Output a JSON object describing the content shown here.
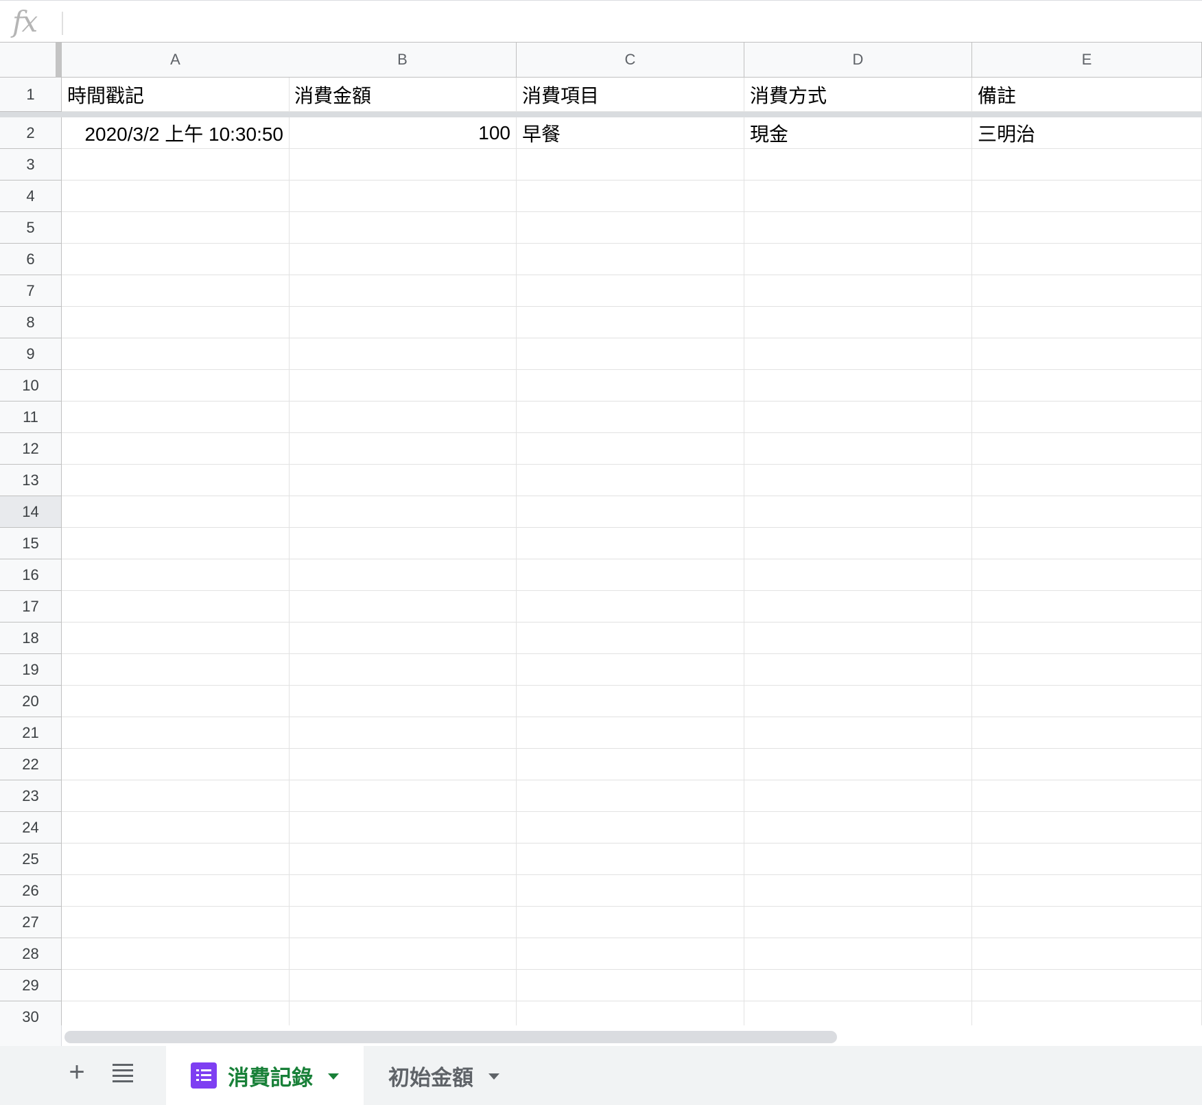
{
  "formula_bar": {
    "fx_label": "fx",
    "value": ""
  },
  "columns": [
    "A",
    "B",
    "C",
    "D",
    "E"
  ],
  "rows": [
    "1",
    "2",
    "3",
    "4",
    "5",
    "6",
    "7",
    "8",
    "9",
    "10",
    "11",
    "12",
    "13",
    "14",
    "15",
    "16",
    "17",
    "18",
    "19",
    "20",
    "21",
    "22",
    "23",
    "24",
    "25",
    "26",
    "27",
    "28",
    "29",
    "30"
  ],
  "cells": {
    "header": [
      "時間戳記",
      "消費金額",
      "消費項目",
      "消費方式",
      "備註"
    ],
    "row2": [
      "2020/3/2 上午 10:30:50",
      "100",
      "早餐",
      "現金",
      "三明治"
    ]
  },
  "sheet_tabs": {
    "add_label": "+",
    "tabs": [
      {
        "label": "消費記錄",
        "active": true
      },
      {
        "label": "初始金額",
        "active": false
      }
    ]
  },
  "colors": {
    "active_tab_text": "#188038",
    "form_icon": "#7e3ff2",
    "header_bg": "#f8f9fa"
  }
}
